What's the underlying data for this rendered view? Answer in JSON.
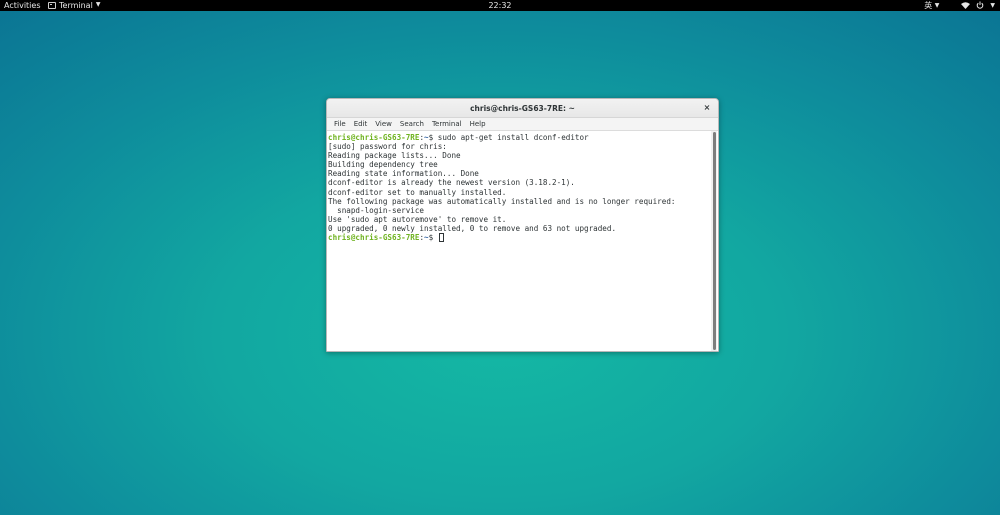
{
  "topbar": {
    "activities": "Activities",
    "app_name": "Terminal",
    "clock": "22:32",
    "input_method": "英",
    "icons": [
      "terminal-icon",
      "chevron-down-icon",
      "wifi-icon",
      "power-icon"
    ]
  },
  "window": {
    "title": "chris@chris-GS63-7RE: ~",
    "close_glyph": "×",
    "menu": [
      "File",
      "Edit",
      "View",
      "Search",
      "Terminal",
      "Help"
    ]
  },
  "terminal": {
    "prompt_user": "chris@chris-GS63-7RE",
    "prompt_sep": ":",
    "prompt_path": "~",
    "prompt_symbol": "$ ",
    "command": "sudo apt-get install dconf-editor",
    "output": [
      "[sudo] password for chris:",
      "Reading package lists... Done",
      "Building dependency tree",
      "Reading state information... Done",
      "dconf-editor is already the newest version (3.18.2-1).",
      "dconf-editor set to manually installed.",
      "The following package was automatically installed and is no longer required:",
      "  snapd-login-service",
      "Use 'sudo apt autoremove' to remove it.",
      "0 upgraded, 0 newly installed, 0 to remove and 63 not upgraded."
    ]
  },
  "colors": {
    "prompt_user": "#6fb320",
    "prompt_path": "#3465a4",
    "desktop": "#12a7a1"
  }
}
